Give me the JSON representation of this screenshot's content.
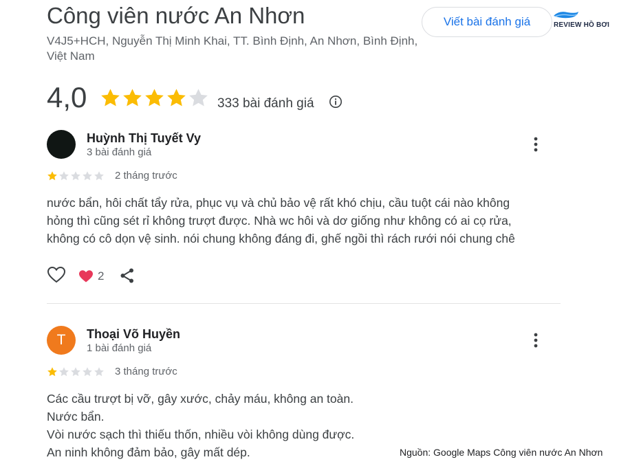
{
  "place": {
    "name": "Công viên nước An Nhơn",
    "address": "V4J5+HCH, Nguyễn Thị Minh Khai, TT. Bình Định, An Nhơn, Bình Định, Việt Nam"
  },
  "write_review_label": "Viết bài đánh giá",
  "logo_text": "REVIEW HỒ BƠI",
  "summary": {
    "rating": "4,0",
    "stars_filled": 4,
    "stars_total": 5,
    "review_count": "333 bài đánh giá"
  },
  "reviews": [
    {
      "name": "Huỳnh Thị Tuyết Vy",
      "meta": "3 bài đánh giá",
      "stars": 1,
      "time": "2 tháng trước",
      "lines": [
        "nước bẩn, hôi chất tẩy rửa, phục vụ và chủ bảo vệ rất khó chịu, cầu tuột cái nào không",
        "hỏng thì cũng sét rỉ không trượt được. Nhà wc hôi và dơ giống như không có ai cọ rửa,",
        "không có cô dọn vệ sinh. nói chung không đáng đi, ghế ngồi thì rách rưới nói chung chê"
      ],
      "reaction_count": "2"
    },
    {
      "name": "Thoại Võ Huyền",
      "initial": "T",
      "meta": "1 bài đánh giá",
      "stars": 1,
      "time": "3 tháng trước",
      "lines": [
        "Các cầu trượt bị vỡ, gây xước, chảy máu, không an toàn.",
        "Nước bẩn.",
        "Vòi nước sạch thì thiếu thốn, nhiều vòi không dùng được.",
        "An ninh không đảm bảo, gây mất dép."
      ]
    }
  ],
  "source_note": "Nguồn: Google Maps Công viên nước An Nhơn",
  "colors": {
    "star_filled": "#fbbc04",
    "star_empty": "#dadce0",
    "accent_blue": "#1a73e8",
    "heart": "#e8385a",
    "avatar_orange": "#f07a1d"
  }
}
